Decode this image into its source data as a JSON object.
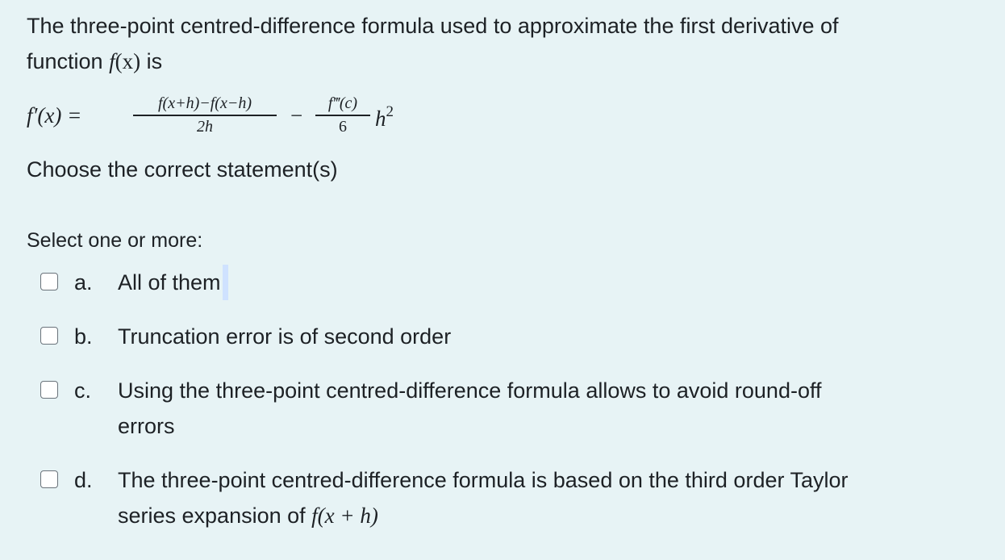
{
  "question": {
    "line1": "The three-point centred-difference formula used to approximate the first derivative of",
    "line2_prefix": "function ",
    "line2_func": "f",
    "line2_arg": "(x)",
    "line2_suffix": " is",
    "formula": {
      "lhs": "f′(x) =",
      "frac1_num": "f(x+h)−f(x−h)",
      "frac1_den": "2h",
      "minus": "−",
      "frac2_num": "f‴(c)",
      "frac2_den": "6",
      "tail": "h",
      "tail_exp": "2"
    },
    "prompt": "Choose the correct statement(s)"
  },
  "select_label": "Select one or more:",
  "options": [
    {
      "letter": "a.",
      "text": "All of them",
      "checked": false
    },
    {
      "letter": "b.",
      "text": "Truncation error is of second order",
      "checked": false
    },
    {
      "letter": "c.",
      "text_line1": "Using the three-point centred-difference formula allows to avoid round-off",
      "text_line2": "errors",
      "checked": false
    },
    {
      "letter": "d.",
      "text_line1": "The three-point centred-difference formula is based on the third order Taylor",
      "text_line2_prefix": "series expansion of ",
      "text_line2_math": "f(x + h)",
      "checked": false
    }
  ]
}
